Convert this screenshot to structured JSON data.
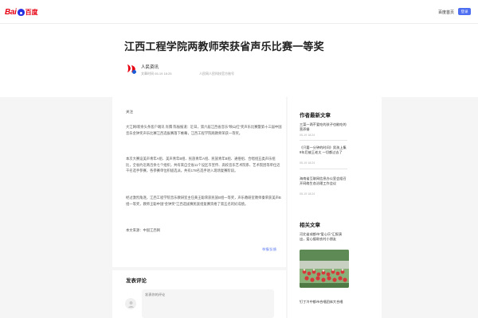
{
  "header": {
    "logo_text_left": "Bai",
    "logo_text_right": "百度",
    "home_link": "百度首页",
    "login_button": "登录"
  },
  "article": {
    "title": "江西工程学院两教师荣获省声乐比赛一等奖",
    "author": "人民资讯",
    "time": "文章时间 05-19 18:25",
    "source": "人民网人民科技官方账号",
    "follow_label": "关注",
    "paragraphs": [
      "大江网/新余头条客户端讯 肖腾 陈振报道：近日，第六届江西省音乐“映山红”奖声乐比赛暨第十三届中国音乐金钟奖声乐比赛江西选拔赛落下帷幕，江西工程学院两教师荣获一等奖。",
      "本次大赛设美声青年A组、美声青年B组、民族青年A组、民族青年B组、通俗组、合唱组五类声乐组比，全省约近两百余七个组织，共有来自全省11个设区市宣传、高校音乐艺术院系、艺术院团等单位近千名选手参赛，各参赛单位积极选派，共有178名选手进入现场复赛阶段。",
      "经过激烈角逐，江西工程学院音乐教研室主任黄王聪荣获民族B组一等奖，声乐教研室教师秦荣获美声B组一等奖，教师王聪中国“金钟奖”江西选拔赛民族组复赛资格了第五名的好成绩。",
      "本文来源：中国江西网"
    ],
    "report_link": "举报/反馈"
  },
  "comments": {
    "heading": "发表评论",
    "placeholder": "发表你的评论"
  },
  "sidebar": {
    "latest_heading": "作者最新文章",
    "latest": [
      {
        "title": "三菜一两不爱吃的孩子也能吃的营养餐",
        "date": "05-19 18:24"
      },
      {
        "title": "《只要一分钟的时间》男孩上集 9年后被王老太 一切都过去了",
        "date": "05-19 18:24"
      },
      {
        "title": "海南省互联网信息办公室会组召开网络生态治理工作会议",
        "date": "05-19 18:24"
      }
    ],
    "related_heading": "相关文章",
    "related": [
      {
        "title": "河北省成都市“爱心乐”汇报演出，爱心援助农村小朋友",
        "date": ""
      },
      {
        "title": "钉丁冷中都市合唱团体大合唱",
        "date": ""
      }
    ],
    "colors": {
      "brand_red": "#e60012",
      "brand_blue": "#4e6ef2"
    }
  }
}
